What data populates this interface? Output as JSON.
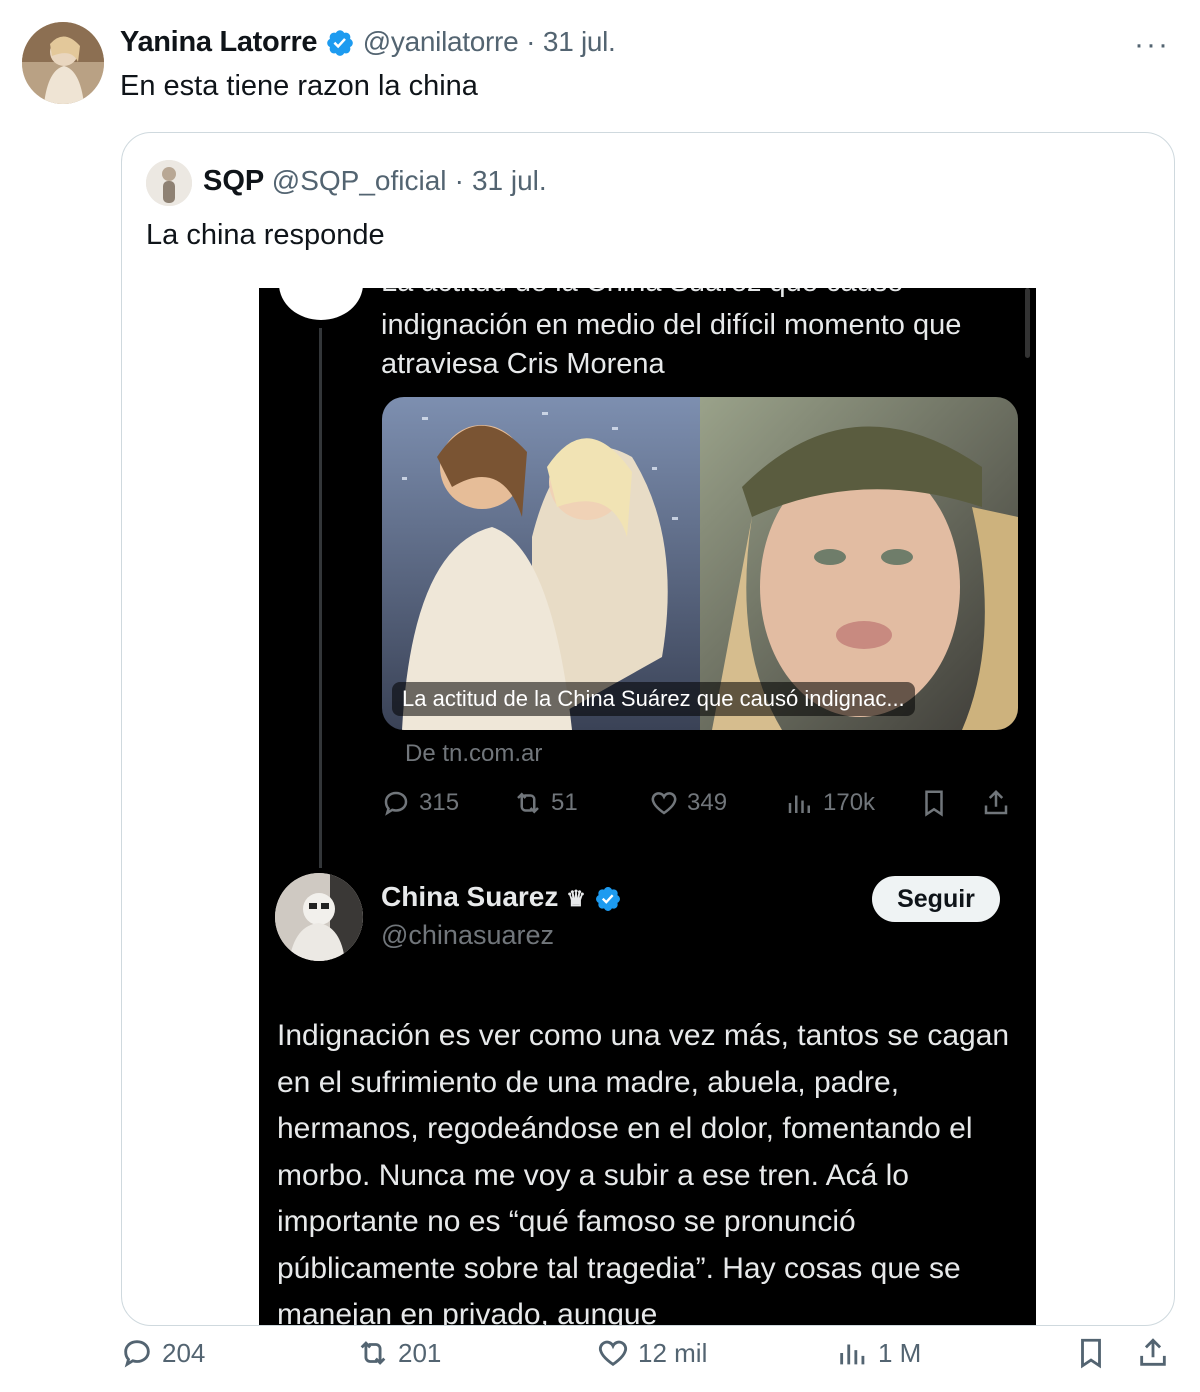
{
  "tweet": {
    "author_name": "Yanina Latorre",
    "handle": "@yanilatorre",
    "separator": "·",
    "date": "31 jul.",
    "text": "En esta tiene razon la china",
    "more": "···",
    "stats": {
      "replies": "204",
      "retweets": "201",
      "likes": "12 mil",
      "views": "1 M"
    }
  },
  "quote": {
    "author_name": "SQP",
    "handle": "@SQP_oficial",
    "separator": "·",
    "date": "31 jul.",
    "text": "La china responde"
  },
  "embedded": {
    "article_partial": "La actitud de la China Suárez que causó",
    "article_title": "indignación en medio del difícil momento que atraviesa Cris Morena",
    "card_caption": "La actitud de la China Suárez que causó indignac...",
    "source": "De tn.com.ar",
    "stats": {
      "replies": "315",
      "retweets": "51",
      "likes": "349",
      "views": "170k"
    },
    "reply": {
      "author_name": "China Suarez",
      "crown": "♛",
      "handle": "@chinasuarez",
      "follow_label": "Seguir",
      "text": "Indignación es ver como una vez más, tantos se cagan en el sufrimiento de una madre, abuela, padre, hermanos, regodeándose en el dolor, fomentando el morbo. Nunca me voy a subir a ese tren. Acá lo importante no es “qué famoso se pronunció públicamente sobre tal tragedia”. Hay cosas que se manejan en privado, aunque"
    }
  },
  "colors": {
    "verified": "#1d9bf0",
    "text": "#0f1419",
    "muted": "#536471",
    "dark_bg": "#000000"
  }
}
